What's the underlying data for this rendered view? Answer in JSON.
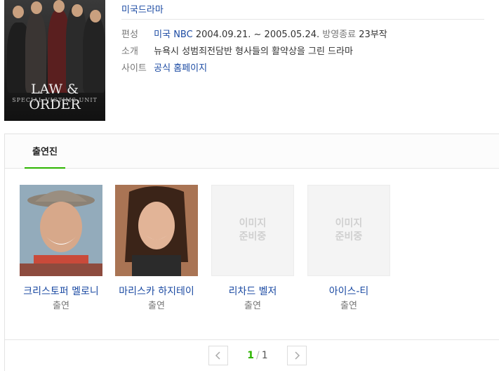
{
  "poster": {
    "title": "LAW & ORDER",
    "subtitle": "SPECIAL VICTIMS UNIT"
  },
  "genre": "미국드라마",
  "info": {
    "broadcast_label": "편성",
    "broadcast_channel": "미국 NBC",
    "broadcast_period": "2004.09.21. ~ 2005.05.24.",
    "broadcast_status": "방영종료",
    "episodes": "23부작",
    "summary_label": "소개",
    "summary": "뉴욕시 성범죄전담반 형사들의 활약상을 그린 드라마",
    "site_label": "사이트",
    "site_link": "공식 홈페이지"
  },
  "cast_tab": "출연진",
  "cast": [
    {
      "name": "크리스토퍼 멜로니",
      "role": "출연"
    },
    {
      "name": "마리스카 하지테이",
      "role": "출연"
    },
    {
      "name": "리차드 벨저",
      "role": "출연",
      "placeholder": "이미지\n준비중"
    },
    {
      "name": "아이스-티",
      "role": "출연",
      "placeholder": "이미지\n준비중"
    }
  ],
  "pager": {
    "current": "1",
    "separator": "/",
    "total": "1",
    "prev_icon": "chevron-left-icon",
    "next_icon": "chevron-right-icon"
  },
  "colors": {
    "link": "#1c4ba3",
    "accent": "#2db400"
  }
}
